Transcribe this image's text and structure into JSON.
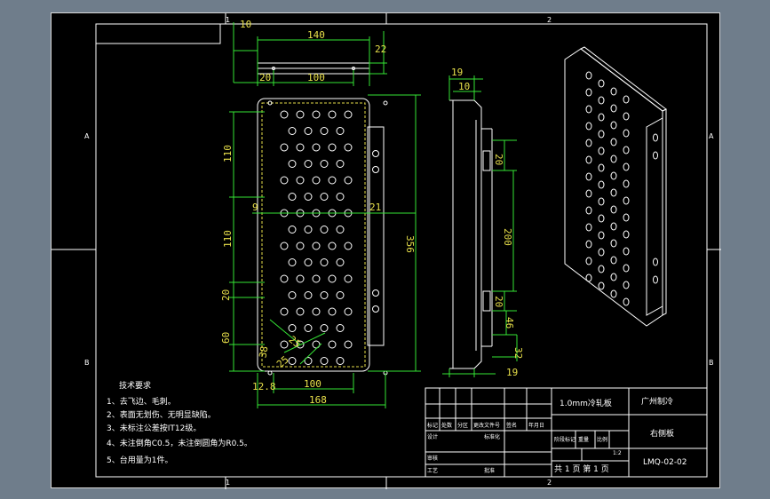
{
  "border": {
    "zones_top": [
      "1",
      "2"
    ],
    "zones_bottom": [
      "1",
      "2"
    ],
    "zones_left": [
      "A",
      "B"
    ],
    "zones_right": [
      "A",
      "B"
    ]
  },
  "dimensions": {
    "top_flange_height": "10",
    "top_length": "140",
    "top_depth": "22",
    "top_offset": "20",
    "top_center": "100",
    "front_pitch_1": "110",
    "front_pitch_2": "110",
    "front_pitch_3": "20",
    "front_pitch_4": "60",
    "front_height": "356",
    "front_hole_x": "9",
    "front_hole_x2": "21",
    "front_corner_1": "38",
    "front_corner_2": "25",
    "front_corner_3": "25",
    "front_margin": "12.8",
    "front_bottom_center": "100",
    "front_width": "168",
    "side_depth": "19",
    "side_flange": "10",
    "side_slot": "20",
    "side_span": "200",
    "side_slot_2": "20",
    "side_offset": "46",
    "side_bottom": "32",
    "side_depth_bottom": "19"
  },
  "notes": {
    "heading": "技术要求",
    "items": [
      "1、去飞边、毛刺。",
      "2、表面无划伤、无明显缺陷。",
      "3、未标注公差按IT12级。",
      "4、未注倒角C0.5，未注倒圆角为R0.5。",
      "5、台用量为1件。"
    ]
  },
  "title_block": {
    "material": "1.0mm冷轧板",
    "company": "广州制冷",
    "part_name": "右侧板",
    "drawing_no": "LMQ-02-02",
    "sheet_info": "共 1 页  第 1 页",
    "scale": "1:2",
    "row_labels": [
      "标记",
      "处数",
      "分区",
      "更改文件号",
      "签名",
      "年月日",
      "设计",
      "标准化",
      "审核",
      "工艺",
      "批准"
    ],
    "stage_labels": [
      "阶段标记",
      "重量",
      "比例"
    ]
  }
}
